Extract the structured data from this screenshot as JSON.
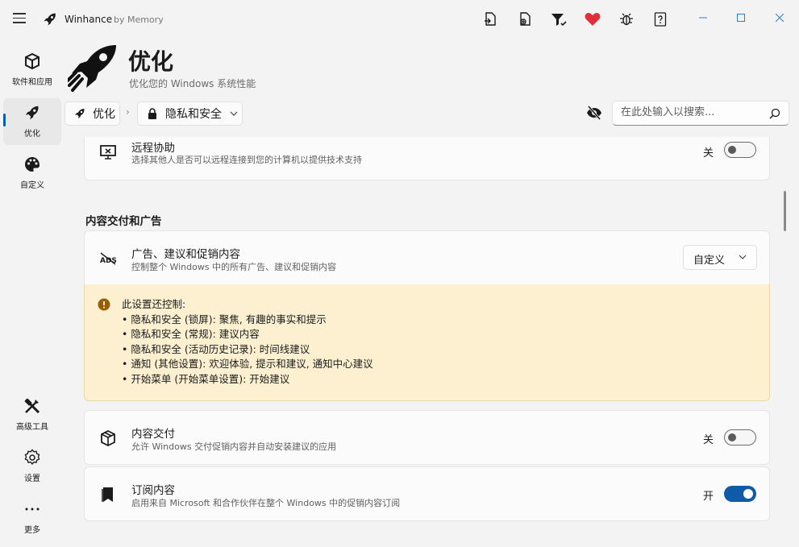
{
  "app": {
    "name": "Winhance",
    "by": "by Memory"
  },
  "titlebar_icons": [
    "export-config-icon",
    "import-config-icon",
    "filter-icon",
    "donate-heart-icon",
    "bug-report-icon",
    "help-icon"
  ],
  "colors": {
    "accent": "#0f5ba7",
    "heart": "#e0303a",
    "warning_bg": "#fcf0d0",
    "warning_icon": "#9a5d00"
  },
  "nav": {
    "items": [
      {
        "id": "software",
        "label": "软件和应用",
        "icon": "cube-icon"
      },
      {
        "id": "optimize",
        "label": "优化",
        "icon": "rocket-icon",
        "active": true
      },
      {
        "id": "customize",
        "label": "自定义",
        "icon": "palette-icon"
      }
    ],
    "bottom": [
      {
        "id": "advanced",
        "label": "高级工具",
        "icon": "tools-icon"
      },
      {
        "id": "settings",
        "label": "设置",
        "icon": "gear-icon"
      },
      {
        "id": "more",
        "label": "更多",
        "icon": "more-icon"
      }
    ]
  },
  "header": {
    "title": "优化",
    "subtitle": "优化您的 Windows 系统性能"
  },
  "breadcrumb": {
    "root": "优化",
    "current": "隐私和安全"
  },
  "search": {
    "placeholder": "在此处输入以搜索...",
    "value": ""
  },
  "remote": {
    "title": "远程协助",
    "desc": "选择其他人是否可以远程连接到您的计算机以提供技术支持",
    "state_label": "关",
    "on": false
  },
  "section": {
    "title": "内容交付和广告"
  },
  "ads": {
    "title": "广告、建议和促销内容",
    "desc": "控制整个 Windows 中的所有广告、建议和促销内容",
    "dropdown_value": "自定义"
  },
  "warning": {
    "lines": [
      "此设置还控制:",
      "• 隐私和安全 (锁屏): 聚焦, 有趣的事实和提示",
      "• 隐私和安全 (常规): 建议内容",
      "• 隐私和安全 (活动历史记录): 时间线建议",
      "• 通知 (其他设置): 欢迎体验, 提示和建议, 通知中心建议",
      "• 开始菜单 (开始菜单设置): 开始建议"
    ]
  },
  "content_delivery": {
    "title": "内容交付",
    "desc": "允许 Windows 交付促销内容并自动安装建议的应用",
    "state_label": "关",
    "on": false
  },
  "subscribed": {
    "title": "订阅内容",
    "desc": "启用来自 Microsoft 和合作伙伴在整个 Windows 中的促销内容订阅",
    "state_label": "开",
    "on": true
  }
}
